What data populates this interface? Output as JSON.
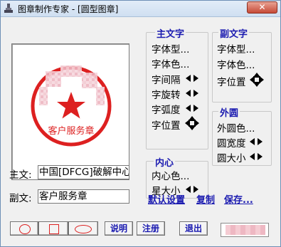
{
  "window": {
    "title": "图章制作专家 - [圆型图章]",
    "close_glyph": "✕"
  },
  "preview": {
    "seal_text": "客户服务章",
    "seal_color": "#dd2020"
  },
  "main_text_group": {
    "title": "主文字",
    "font_type": "字体型...",
    "font_color": "字体色...",
    "spacing": "字间隔",
    "rotation": "字旋转",
    "arc": "字弧度",
    "position": "字位置"
  },
  "sub_text_group": {
    "title": "副文字",
    "font_type": "字体型...",
    "font_color": "字体色...",
    "position": "字位置"
  },
  "outer_circle_group": {
    "title": "外圆",
    "color": "外圆色...",
    "width": "圆宽度",
    "size": "圆大小"
  },
  "inner_group": {
    "title": "内心",
    "color": "内心色...",
    "star_size": "星大小"
  },
  "main_text_field": {
    "label": "主文:",
    "value": "中国[DFCG]破解中心"
  },
  "sub_text_field": {
    "label": "副文:",
    "value": "客户服务章"
  },
  "links": {
    "default": "默认设置",
    "copy": "复制",
    "save": "保存..."
  },
  "buttons": {
    "help": "说明",
    "register": "注册",
    "exit": "退出"
  },
  "icons": {
    "app": "stamp-icon",
    "close": "close-icon",
    "move": "move-arrows-icon",
    "left": "triangle-left-icon",
    "right": "triangle-right-icon"
  }
}
